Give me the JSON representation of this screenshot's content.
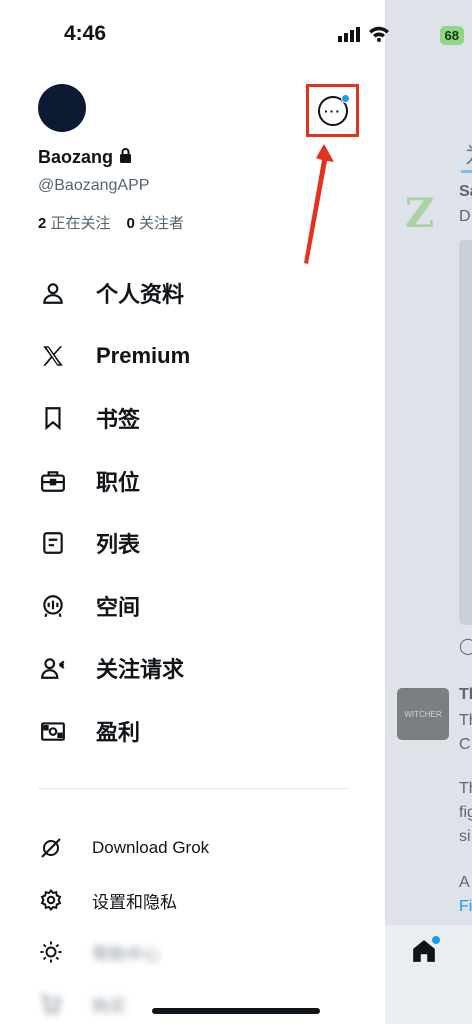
{
  "status_bar": {
    "time": "4:46",
    "battery": "68"
  },
  "profile": {
    "display_name": "Baozang",
    "handle": "@BaozangAPP",
    "following_count": "2",
    "following_label": "正在关注",
    "followers_count": "0",
    "followers_label": "关注者"
  },
  "menu": {
    "items": [
      {
        "label": "个人资料",
        "icon": "person-icon"
      },
      {
        "label": "Premium",
        "icon": "x-logo-icon"
      },
      {
        "label": "书签",
        "icon": "bookmark-icon"
      },
      {
        "label": "职位",
        "icon": "briefcase-icon"
      },
      {
        "label": "列表",
        "icon": "list-icon"
      },
      {
        "label": "空间",
        "icon": "spaces-icon"
      },
      {
        "label": "关注请求",
        "icon": "follow-request-icon"
      },
      {
        "label": "盈利",
        "icon": "money-icon"
      }
    ]
  },
  "secondary": {
    "items": [
      {
        "label": "Download Grok",
        "icon": "grok-icon"
      },
      {
        "label": "设置和隐私",
        "icon": "gear-icon"
      },
      {
        "label": "帮助中心",
        "icon": "sun-icon"
      },
      {
        "label": "购买",
        "icon": "cart-icon"
      }
    ]
  },
  "background_timeline": {
    "tab_fragment": "为",
    "post1_author_fragment": "Sa",
    "post1_text_fragment": "D",
    "post2_author_fragment": "Th",
    "post2_line1_fragment": "Th",
    "post2_line2_fragment": "C",
    "post2_line3_fragment": "Th",
    "post2_line4_fragment": "fig",
    "post2_line5_fragment": "si",
    "post2_line6_fragment": "A",
    "post2_line7_fragment": "Fi",
    "thumb_text": "WITCHER"
  },
  "colors": {
    "accent": "#1d9bf0",
    "highlight_box": "#e5321e"
  }
}
